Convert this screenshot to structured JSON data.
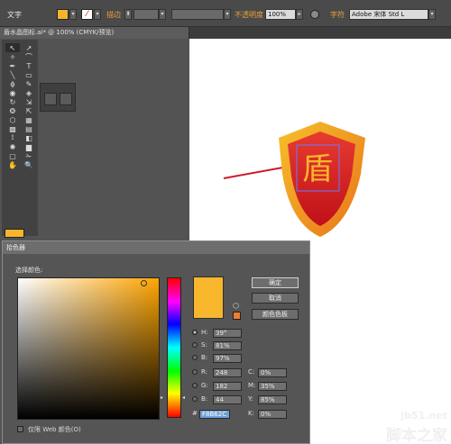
{
  "control_bar": {
    "left_label": "文字",
    "stroke_label": "描边",
    "stroke_value": "",
    "opacity_label": "不透明度",
    "opacity_value": "100%",
    "char_label": "字符",
    "font_value": "Adobe 宋体 Std L",
    "fill_color": "#f6b62c"
  },
  "document_tab": {
    "label": "盾水晶图标.ai* @ 100% (CMYK/预览)"
  },
  "tools": {
    "icons": [
      "selection-arrow-icon",
      "direct-select-icon",
      "magic-wand-icon",
      "lasso-icon",
      "pen-icon",
      "type-icon",
      "line-icon",
      "rectangle-icon",
      "paintbrush-icon",
      "pencil-icon",
      "blob-brush-icon",
      "eraser-icon",
      "rotate-icon",
      "scale-icon",
      "width-icon",
      "free-transform-icon",
      "shape-builder-icon",
      "perspective-icon",
      "mesh-icon",
      "gradient-icon",
      "eyedropper-icon",
      "blend-icon",
      "symbol-sprayer-icon",
      "column-graph-icon",
      "artboard-icon",
      "slice-icon",
      "hand-icon",
      "zoom-icon"
    ],
    "glyphs": [
      "↖",
      "↗",
      "✧",
      "⌒",
      "✒",
      "T",
      "╲",
      "▭",
      "ɸ",
      "✎",
      "◉",
      "◈",
      "↻",
      "⇲",
      "❂",
      "⇱",
      "⬡",
      "▦",
      "▩",
      "▤",
      "⟟",
      "◧",
      "✺",
      "▆",
      "▢",
      "✁",
      "✋",
      "🔍"
    ],
    "fill_color": "#f6b62c"
  },
  "picker": {
    "title": "拾色器",
    "select_label": "选择颜色:",
    "new_color": "#f8b62c",
    "warning_color": "#ed7f2f",
    "buttons": {
      "ok": "确定",
      "cancel": "取消",
      "swatches": "颜色色板"
    },
    "hsb": [
      {
        "label": "H:",
        "value": "39°",
        "selected": true
      },
      {
        "label": "S:",
        "value": "81%",
        "selected": false
      },
      {
        "label": "B:",
        "value": "97%",
        "selected": false
      }
    ],
    "rgb": [
      {
        "label": "R:",
        "value": "248"
      },
      {
        "label": "G:",
        "value": "182"
      },
      {
        "label": "B:",
        "value": "44"
      }
    ],
    "cmyk": [
      {
        "label": "C:",
        "value": "0%"
      },
      {
        "label": "M:",
        "value": "35%"
      },
      {
        "label": "Y:",
        "value": "85%"
      },
      {
        "label": "K:",
        "value": "0%"
      }
    ],
    "hex_label": "#",
    "hex_value": "F8B62C",
    "web_only_label": "仅限 Web 颜色(O)"
  },
  "artwork": {
    "shield_glyph": "盾"
  },
  "watermark": {
    "url": "jb51.net",
    "text": "脚本之家"
  }
}
